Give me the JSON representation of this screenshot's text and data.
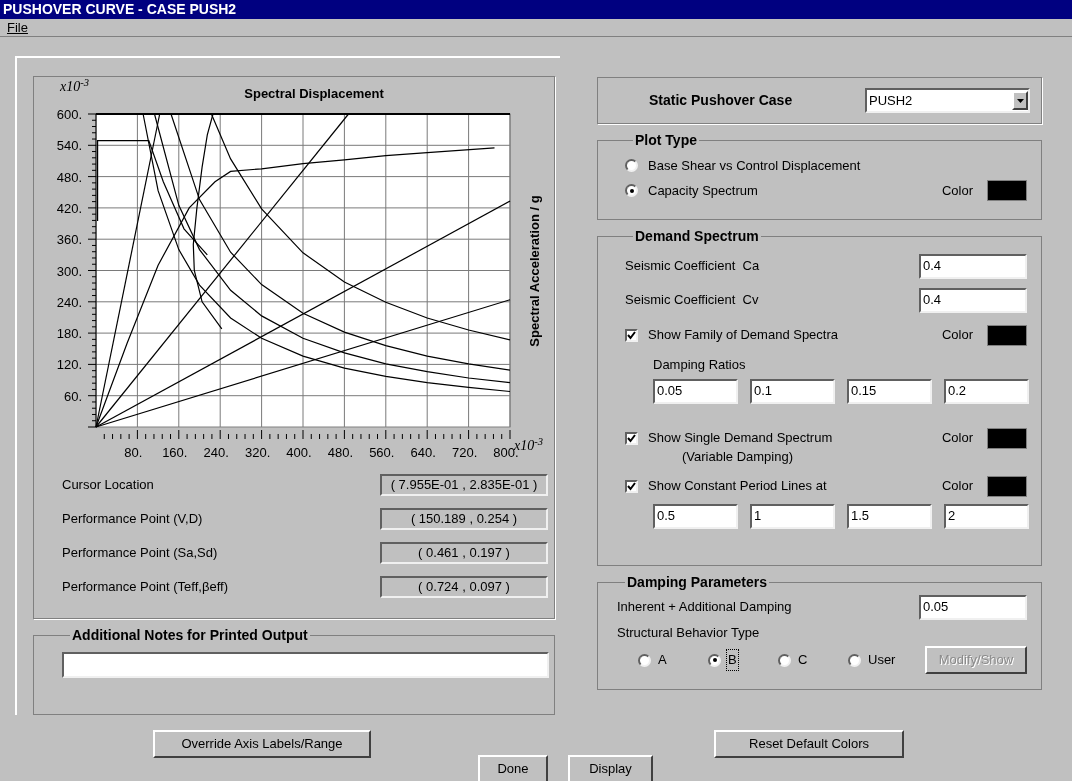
{
  "window": {
    "title": "PUSHOVER CURVE - CASE PUSH2"
  },
  "menu": [
    {
      "label": "File",
      "underline_first": true
    }
  ],
  "chart_panel": {
    "x_multiplier": "x10$^{-3}$",
    "y_multiplier": "x10$^{-3}$",
    "chart_data": {
      "type": "line",
      "grid": true,
      "xlabel": "Spectral Displacement",
      "ylabel": "Spectral Acceleration / g",
      "xlim": [
        0,
        800
      ],
      "ylim": [
        0,
        600
      ],
      "xticks": [
        {
          "value": 80,
          "label": "80."
        },
        {
          "value": 160,
          "label": "160."
        },
        {
          "value": 240,
          "label": "240."
        },
        {
          "value": 320,
          "label": "320."
        },
        {
          "value": 400,
          "label": "400."
        },
        {
          "value": 480,
          "label": "480."
        },
        {
          "value": 560,
          "label": "560."
        },
        {
          "value": 640,
          "label": "640."
        },
        {
          "value": 720,
          "label": "720."
        },
        {
          "value": 800,
          "label": "800."
        }
      ],
      "yticks": [
        {
          "value": 60,
          "label": "60."
        },
        {
          "value": 120,
          "label": "120."
        },
        {
          "value": 180,
          "label": "180."
        },
        {
          "value": 240,
          "label": "240."
        },
        {
          "value": 300,
          "label": "300."
        },
        {
          "value": 360,
          "label": "360."
        },
        {
          "value": 420,
          "label": "420."
        },
        {
          "value": 480,
          "label": "480."
        },
        {
          "value": 540,
          "label": "540."
        },
        {
          "value": 600,
          "label": "600."
        }
      ],
      "series": [
        {
          "color": "#000000",
          "x": [
            0,
            60,
            120,
            180,
            230,
            260,
            320,
            400,
            480,
            560,
            640,
            770
          ],
          "values": [
            0,
            160,
            310,
            420,
            470,
            490,
            495,
            505,
            512,
            520,
            526,
            535
          ]
        },
        {
          "color": "#000000",
          "x": [
            223,
            260,
            320,
            400,
            480,
            560,
            640,
            720,
            800
          ],
          "values": [
            600,
            514,
            418,
            334,
            278,
            239,
            209,
            186,
            167
          ]
        },
        {
          "color": "#000000",
          "x": [
            145,
            200,
            260,
            320,
            400,
            480,
            560,
            640,
            720,
            800
          ],
          "values": [
            600,
            436,
            335,
            273,
            218,
            182,
            156,
            136,
            121,
            109
          ]
        },
        {
          "color": "#000000",
          "x": [
            113,
            160,
            200,
            260,
            320,
            400,
            480,
            560,
            640,
            720,
            800
          ],
          "values": [
            600,
            425,
            340,
            262,
            213,
            170,
            142,
            121,
            106,
            94,
            85
          ]
        },
        {
          "color": "#000000",
          "x": [
            91,
            120,
            160,
            200,
            260,
            320,
            400,
            480,
            560,
            640,
            720,
            800
          ],
          "values": [
            600,
            453,
            340,
            272,
            209,
            170,
            136,
            113,
            97,
            85,
            76,
            68
          ]
        },
        {
          "color": "#000000",
          "x": [
            226,
            215,
            205,
            195,
            188,
            190,
            205,
            243
          ],
          "values": [
            600,
            560,
            498,
            420,
            350,
            300,
            240,
            188
          ]
        },
        {
          "color": "#000000",
          "x": [
            3,
            3,
            102,
            130,
            170,
            215
          ],
          "values": [
            395,
            549,
            549,
            470,
            380,
            330
          ]
        },
        {
          "color": "#000000",
          "x": [
            0,
            123
          ],
          "values": [
            0,
            600
          ]
        },
        {
          "color": "#000000",
          "x": [
            0,
            488
          ],
          "values": [
            0,
            600
          ]
        },
        {
          "color": "#000000",
          "x": [
            0,
            800
          ],
          "values": [
            0,
            433
          ]
        },
        {
          "color": "#000000",
          "x": [
            0,
            800
          ],
          "values": [
            0,
            244
          ]
        }
      ]
    }
  },
  "readouts": [
    {
      "label": "Cursor Location",
      "value": "( 7.955E-01 , 2.835E-01 )"
    },
    {
      "label": "Performance Point (V,D)",
      "value": "( 150.189 , 0.254 )"
    },
    {
      "label": "Performance Point (Sa,Sd)",
      "value": "( 0.461 , 0.197 )"
    },
    {
      "label": "Performance Point (Teff,βeff)",
      "value": "( 0.724 , 0.097 )"
    }
  ],
  "notes": {
    "title": "Additional Notes for Printed Output"
  },
  "case_selector": {
    "label": "Static Pushover Case",
    "value": "PUSH2"
  },
  "plot_type": {
    "title": "Plot Type",
    "options": [
      {
        "label": "Base Shear vs Control Displacement",
        "selected": false
      },
      {
        "label": "Capacity Spectrum",
        "selected": true
      }
    ],
    "color_label": "Color",
    "color": "#000000"
  },
  "demand_spectrum": {
    "title": "Demand Spectrum",
    "coefficients": [
      {
        "label": "Seismic Coefficient  Ca",
        "value": "0.4"
      },
      {
        "label": "Seismic Coefficient  Cv",
        "value": "0.4"
      }
    ],
    "family": {
      "label": "Show Family of Demand Spectra",
      "checked": true,
      "color_label": "Color",
      "color": "#000000"
    },
    "damping_ratios_label": "Damping Ratios",
    "damping_ratios": [
      "0.05",
      "0.1",
      "0.15",
      "0.2"
    ],
    "single": {
      "label": "Show Single  Demand Spectrum",
      "sublabel": "(Variable Damping)",
      "checked": true,
      "color_label": "Color",
      "color": "#000000"
    },
    "period_lines": {
      "label": "Show Constant Period Lines at",
      "checked": true,
      "color_label": "Color",
      "color": "#000000",
      "values": [
        "0.5",
        "1",
        "1.5",
        "2"
      ]
    }
  },
  "damping_parameters": {
    "title": "Damping Parameters",
    "inherent": {
      "label": "Inherent + Additional Damping",
      "value": "0.05"
    },
    "behavior_label": "Structural Behavior Type",
    "behavior_options": [
      {
        "label": "A",
        "selected": false,
        "focused": false
      },
      {
        "label": "B",
        "selected": true,
        "focused": true
      },
      {
        "label": "C",
        "selected": false,
        "focused": false
      },
      {
        "label": "User",
        "selected": false,
        "focused": false
      }
    ],
    "modify_button": {
      "label": "Modify/Show",
      "disabled": true
    }
  },
  "buttons": [
    {
      "label": "Override Axis Labels/Range"
    },
    {
      "label": "Reset Default Colors"
    },
    {
      "label": "Done"
    },
    {
      "label": "Display"
    }
  ]
}
